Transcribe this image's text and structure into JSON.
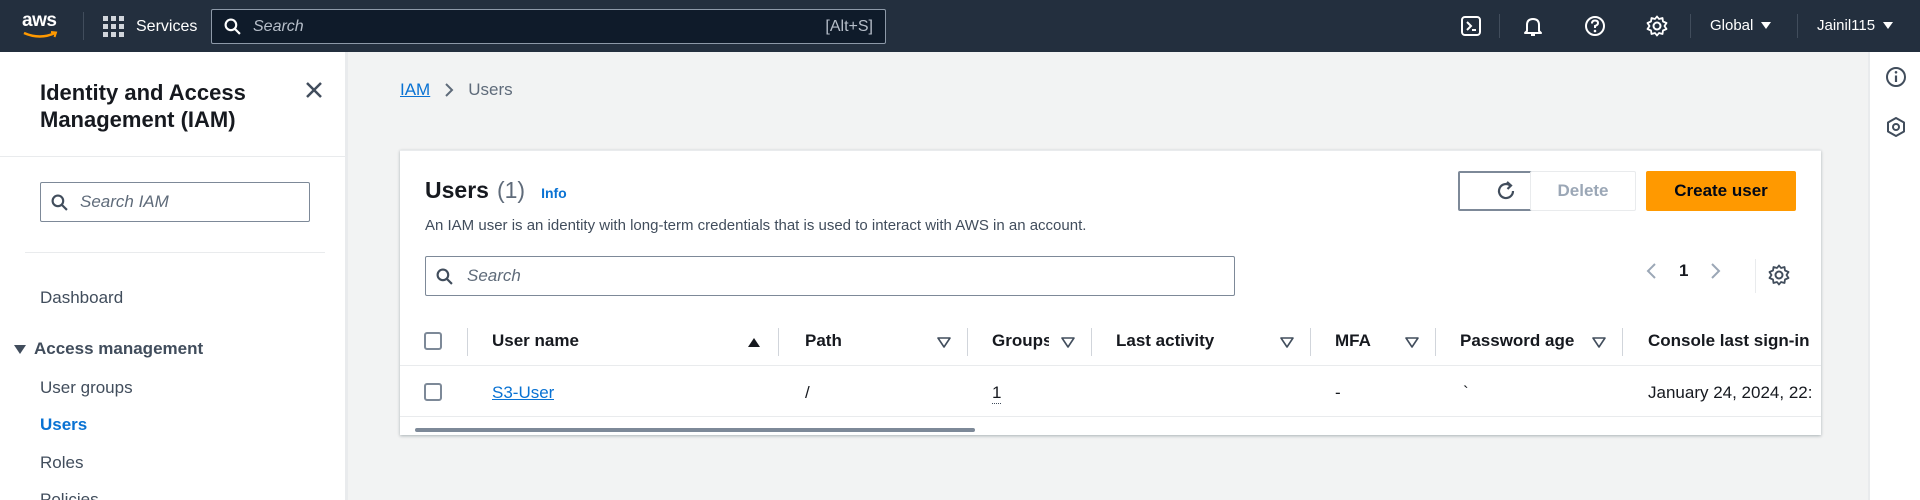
{
  "topnav": {
    "logo_text": "aws",
    "services_label": "Services",
    "search_placeholder": "Search",
    "search_shortcut": "[Alt+S]",
    "region": "Global",
    "account": "Jainil115",
    "icons": [
      "cloudshell-icon",
      "notifications-icon",
      "help-icon",
      "settings-icon"
    ]
  },
  "sidebar": {
    "title": "Identity and Access Management (IAM)",
    "search_placeholder": "Search IAM",
    "dashboard": "Dashboard",
    "section": "Access management",
    "items": [
      "User groups",
      "Users",
      "Roles",
      "Policies"
    ],
    "active": "Users"
  },
  "breadcrumb": {
    "root": "IAM",
    "current": "Users"
  },
  "panel": {
    "title": "Users",
    "count": "(1)",
    "info": "Info",
    "description": "An IAM user is an identity with long-term credentials that is used to interact with AWS in an account.",
    "delete_label": "Delete",
    "create_label": "Create user",
    "search_placeholder": "Search",
    "page": "1"
  },
  "table": {
    "columns": [
      "User name",
      "Path",
      "Groups",
      "Last activity",
      "MFA",
      "Password age",
      "Console last sign-in"
    ],
    "rows": [
      {
        "user_name": "S3-User",
        "path": "/",
        "groups": "1",
        "last_activity": "",
        "mfa": "-",
        "password_age": "`",
        "console_last_sign_in": "January 24, 2024, 22:"
      }
    ]
  },
  "colors": {
    "nav_bg": "#232f3e",
    "link": "#0972d3",
    "primary": "#ff9900"
  }
}
